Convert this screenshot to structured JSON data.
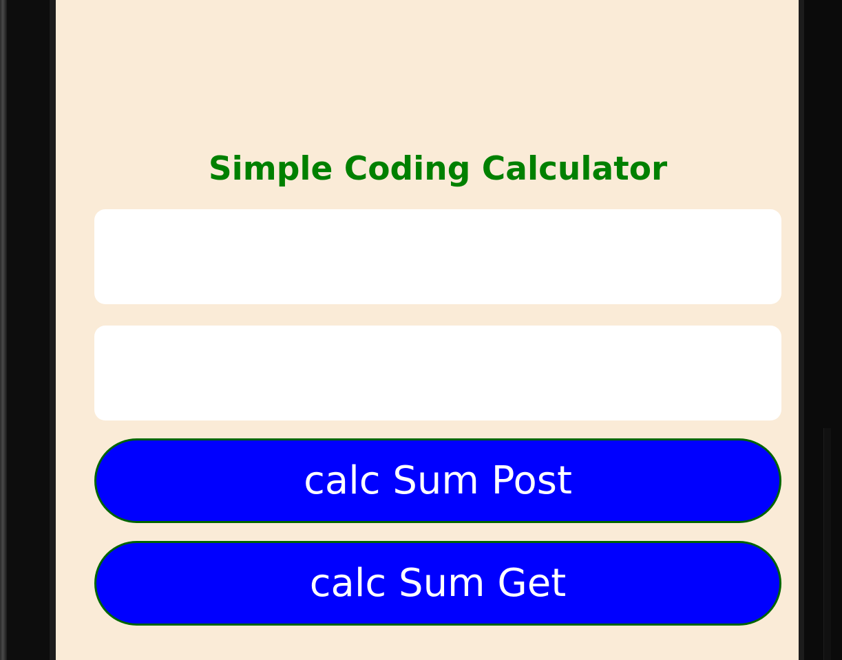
{
  "app": {
    "title": "Simple Coding Calculator"
  },
  "inputs": [
    {
      "value": "",
      "placeholder": ""
    },
    {
      "value": "",
      "placeholder": ""
    }
  ],
  "buttons": {
    "sum_post_label": "calc Sum Post",
    "sum_get_label": "calc Sum Get"
  },
  "colors": {
    "background": "#faebd7",
    "title": "#008000",
    "button_fill": "#0000ff",
    "button_border": "#006400",
    "button_text": "#ffffff",
    "input_fill": "#ffffff",
    "device_frame": "#0b0b0b"
  }
}
